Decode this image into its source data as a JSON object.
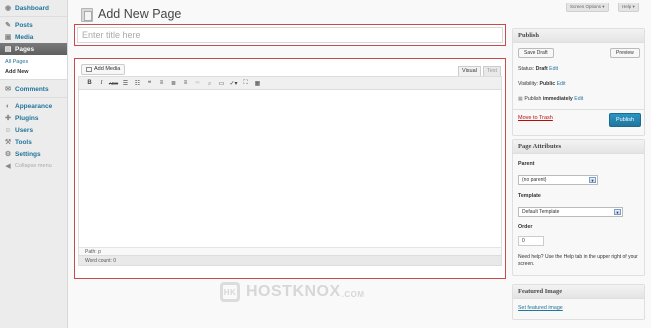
{
  "sidebar": {
    "items": [
      {
        "label": "Dashboard",
        "icon": "dashboard-icon"
      },
      {
        "label": "Posts",
        "icon": "posts-icon"
      },
      {
        "label": "Media",
        "icon": "media-icon"
      },
      {
        "label": "Pages",
        "icon": "pages-icon"
      },
      {
        "label": "Comments",
        "icon": "comments-icon"
      },
      {
        "label": "Appearance",
        "icon": "appearance-icon"
      },
      {
        "label": "Plugins",
        "icon": "plugins-icon"
      },
      {
        "label": "Users",
        "icon": "users-icon"
      },
      {
        "label": "Tools",
        "icon": "tools-icon"
      },
      {
        "label": "Settings",
        "icon": "settings-icon"
      }
    ],
    "submenu": [
      "All Pages",
      "Add New"
    ],
    "collapse": "Collapse menu"
  },
  "top": {
    "screen_options": "Screen Options ▾",
    "help": "Help ▾"
  },
  "header": {
    "title": "Add New Page"
  },
  "title_input": {
    "placeholder": "Enter title here",
    "value": ""
  },
  "editor": {
    "add_media": "Add Media",
    "tab_visual": "Visual",
    "tab_text": "Text",
    "path": "Path: p",
    "word_count": "Word count: 0"
  },
  "publish": {
    "heading": "Publish",
    "save_draft": "Save Draft",
    "preview": "Preview",
    "status_label": "Status:",
    "status_value": "Draft",
    "edit": "Edit",
    "visibility_label": "Visibility:",
    "visibility_value": "Public",
    "publish_label": "Publish",
    "publish_value": "immediately",
    "move_to_trash": "Move to Trash",
    "publish_button": "Publish"
  },
  "page_attributes": {
    "heading": "Page Attributes",
    "parent_label": "Parent",
    "parent_value": "(no parent)",
    "template_label": "Template",
    "template_value": "Default Template",
    "order_label": "Order",
    "order_value": "0",
    "help": "Need help? Use the Help tab in the upper right of your screen."
  },
  "featured_image": {
    "heading": "Featured Image",
    "link": "Set featured image"
  },
  "watermark": {
    "brand": "HOSTKNOX",
    "suffix": ".COM",
    "logo": "HK"
  },
  "colors": {
    "link": "#21759b",
    "highlight_border": "#c94a4a",
    "publish_button": "#21759b",
    "trash": "#bc0b0b"
  }
}
